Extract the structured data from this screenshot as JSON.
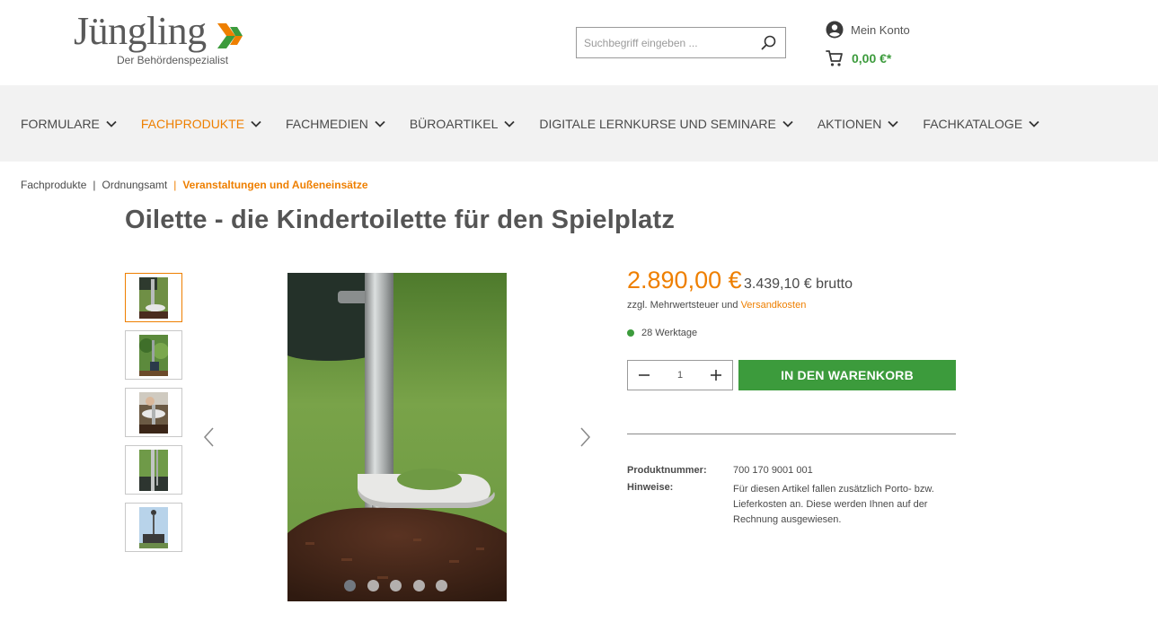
{
  "header": {
    "logo_word": "Jüngling",
    "logo_sub": "Der Behördenspezialist",
    "search": {
      "placeholder": "Suchbegriff eingeben ..."
    },
    "account_label": "Mein Konto",
    "cart_total": "0,00 €*"
  },
  "nav": {
    "items": [
      {
        "label": "FORMULARE",
        "active": false
      },
      {
        "label": "FACHPRODUKTE",
        "active": true
      },
      {
        "label": "FACHMEDIEN",
        "active": false
      },
      {
        "label": "BÜROARTIKEL",
        "active": false
      },
      {
        "label": "DIGITALE LERNKURSE UND SEMINARE",
        "active": false
      },
      {
        "label": "AKTIONEN",
        "active": false
      },
      {
        "label": "FACHKATALOGE",
        "active": false
      }
    ]
  },
  "breadcrumb": {
    "items": [
      "Fachprodukte",
      "Ordnungsamt"
    ],
    "current": "Veranstaltungen und Außeneinsätze"
  },
  "product": {
    "title": "Oilette - die Kindertoilette für den Spielplatz",
    "price": "2.890,00 €",
    "price_gross": "3.439,10 € brutto",
    "tax_note_prefix": "zzgl. Mehrwertsteuer und",
    "tax_note_link": "Versandkosten",
    "delivery": "28 Werktage",
    "quantity": "1",
    "add_to_cart": "IN DEN WARENKORB",
    "properties": [
      {
        "key": "Produktnummer:",
        "value": "700 170 9001 001"
      },
      {
        "key": "Hinweise:",
        "value": "Für diesen Artikel fallen zusätzlich Porto- bzw. Lieferkosten an. Diese werden Ihnen auf der Rechnung ausgewiesen."
      }
    ]
  },
  "gallery": {
    "thumbnail_count": 5,
    "active_index": 0
  },
  "colors": {
    "accent": "#ee7f00",
    "green": "#3c9b3c",
    "text": "#4a4a4a",
    "nav_bg": "#f2f2f2"
  }
}
